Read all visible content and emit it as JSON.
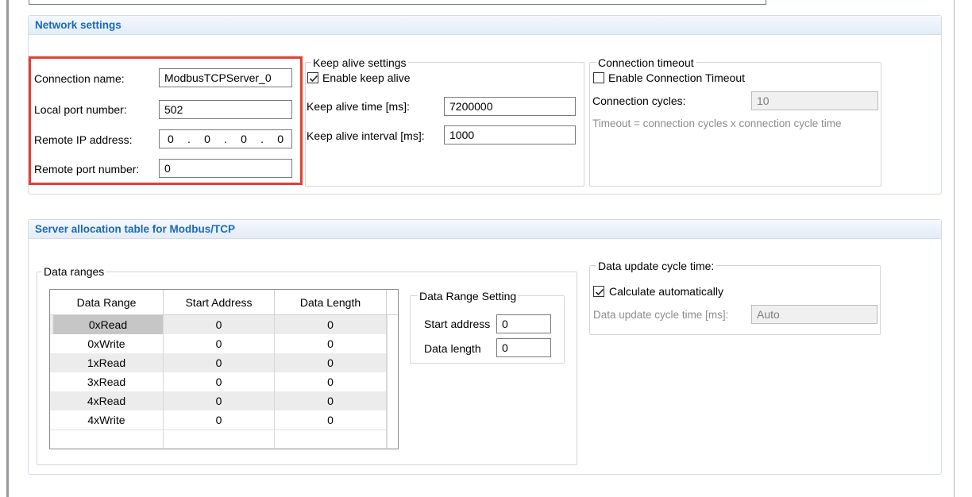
{
  "network": {
    "header": "Network settings",
    "connection_name_label": "Connection name:",
    "connection_name_value": "ModbusTCPServer_0",
    "local_port_label": "Local port number:",
    "local_port_value": "502",
    "remote_ip_label": "Remote IP address:",
    "remote_ip_octets": [
      "0",
      "0",
      "0",
      "0"
    ],
    "remote_port_label": "Remote port number:",
    "remote_port_value": "0",
    "keep_alive": {
      "legend": "Keep alive settings",
      "enable_label": "Enable keep alive",
      "enabled": true,
      "time_label": "Keep alive time [ms]:",
      "time_value": "7200000",
      "interval_label": "Keep alive interval [ms]:",
      "interval_value": "1000"
    },
    "timeout": {
      "legend": "Connection timeout",
      "enable_label": "Enable Connection Timeout",
      "enabled": false,
      "cycles_label": "Connection cycles:",
      "cycles_value": "10",
      "formula": "Timeout = connection cycles x connection cycle time"
    }
  },
  "server": {
    "header": "Server allocation table for Modbus/TCP",
    "data_ranges": {
      "legend": "Data ranges",
      "columns": [
        "Data Range",
        "Start Address",
        "Data Length"
      ],
      "rows": [
        {
          "range": "0xRead",
          "start": "0",
          "length": "0"
        },
        {
          "range": "0xWrite",
          "start": "0",
          "length": "0"
        },
        {
          "range": "1xRead",
          "start": "0",
          "length": "0"
        },
        {
          "range": "3xRead",
          "start": "0",
          "length": "0"
        },
        {
          "range": "4xRead",
          "start": "0",
          "length": "0"
        },
        {
          "range": "4xWrite",
          "start": "0",
          "length": "0"
        }
      ]
    },
    "range_setting": {
      "legend": "Data Range Setting",
      "start_label": "Start address",
      "start_value": "0",
      "length_label": "Data length",
      "length_value": "0"
    },
    "update_cycle": {
      "legend": "Data update cycle time:",
      "auto_label": "Calculate automatically",
      "auto_checked": true,
      "time_label": "Data update cycle time [ms]:",
      "time_value": "Auto"
    }
  },
  "colors": {
    "accent": "#1a6ab5",
    "highlight": "#e63e32"
  }
}
